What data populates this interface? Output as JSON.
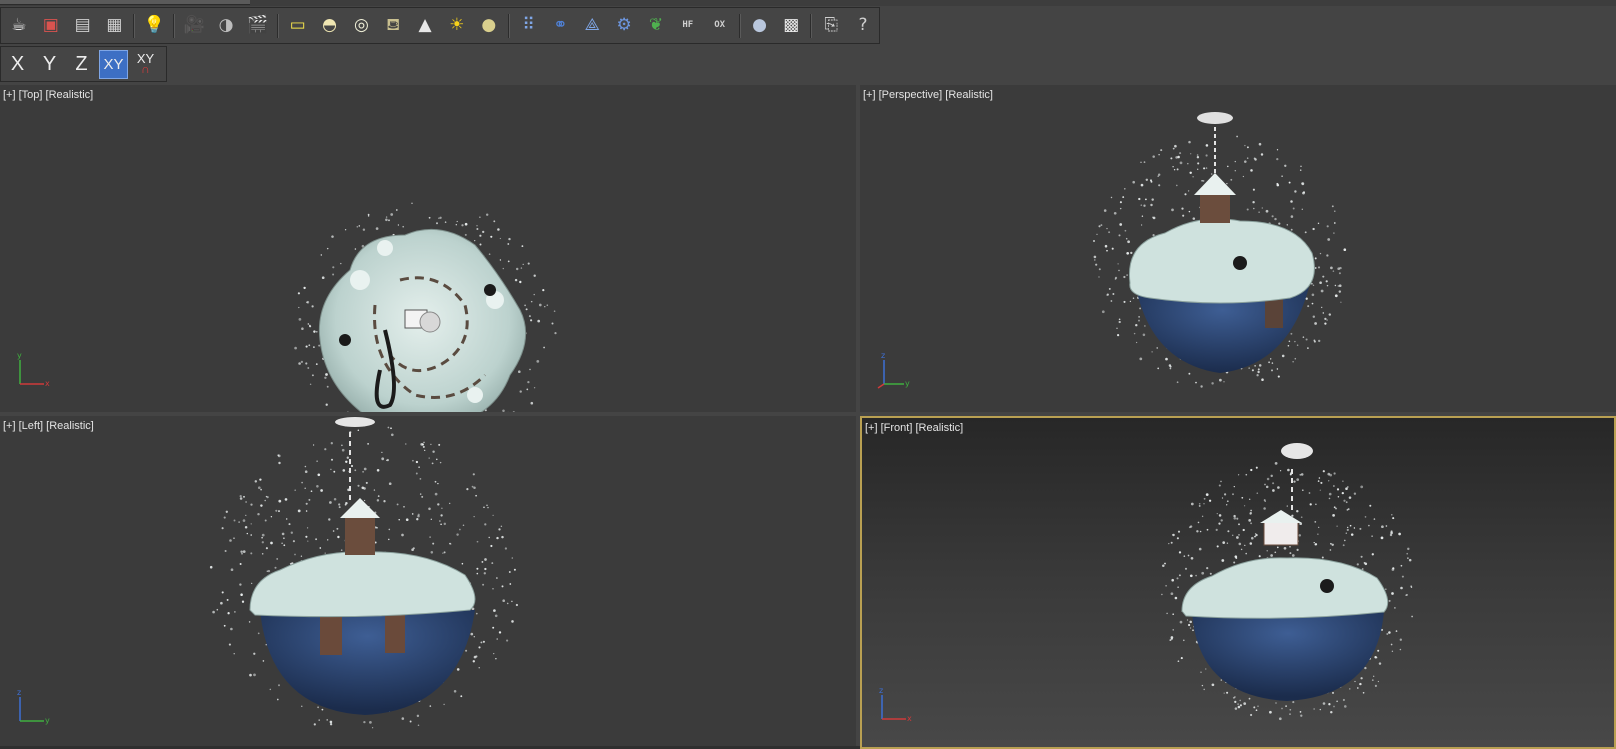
{
  "toolbar": {
    "groups": [
      [
        {
          "name": "teapot-icon",
          "glyph": "☕",
          "color": "#e8e8e8"
        },
        {
          "name": "render-frame-icon",
          "glyph": "▣",
          "color": "#d9534f"
        },
        {
          "name": "material-editor-icon",
          "glyph": "▤",
          "color": "#cfcfcf"
        },
        {
          "name": "schematic-view-icon",
          "glyph": "▦",
          "color": "#cfcfcf"
        }
      ],
      [
        {
          "name": "light-lister-icon",
          "glyph": "💡",
          "color": "#f2e14b"
        }
      ],
      [
        {
          "name": "camera-icon",
          "glyph": "🎥",
          "color": "#cfcfcf"
        },
        {
          "name": "sound-icon",
          "glyph": "◑",
          "color": "#bdbdbd"
        },
        {
          "name": "render-setup-icon",
          "glyph": "🎬",
          "color": "#d9534f"
        }
      ],
      [
        {
          "name": "plane-icon",
          "glyph": "▭",
          "color": "#f2e14b"
        },
        {
          "name": "dome-icon",
          "glyph": "◓",
          "color": "#efe6b2"
        },
        {
          "name": "ring-icon",
          "glyph": "◎",
          "color": "#f0f0d8"
        },
        {
          "name": "teapot-object-icon",
          "glyph": "⛾",
          "color": "#c9c090"
        },
        {
          "name": "cone-icon",
          "glyph": "▲",
          "color": "#e8e8e8"
        },
        {
          "name": "sun-icon",
          "glyph": "☀",
          "color": "#f7d21a"
        },
        {
          "name": "sphere-light-icon",
          "glyph": "●",
          "color": "#d9cf8d"
        }
      ],
      [
        {
          "name": "grid-array-icon",
          "glyph": "⠿",
          "color": "#7fa6e6"
        },
        {
          "name": "molecule-icon",
          "glyph": "⚭",
          "color": "#4f82d9"
        },
        {
          "name": "pyramid-icon",
          "glyph": "⟁",
          "color": "#7fa6e6"
        },
        {
          "name": "gear-icon",
          "glyph": "⚙",
          "color": "#6d96de"
        },
        {
          "name": "grass-icon",
          "glyph": "❦",
          "color": "#4fb04f"
        },
        {
          "name": "hair-fur-icon",
          "glyph": "HF",
          "color": "#cfcfcf",
          "small": true
        },
        {
          "name": "ox-shell-icon",
          "glyph": "OX",
          "color": "#cfcfcf",
          "small": true
        }
      ],
      [
        {
          "name": "material-sphere-icon",
          "glyph": "●",
          "color": "#b9c7dd"
        },
        {
          "name": "checker-map-icon",
          "glyph": "▩",
          "color": "#e8e8e8"
        }
      ],
      [
        {
          "name": "render-preset-icon",
          "glyph": "⎘",
          "color": "#cfcfcf"
        },
        {
          "name": "help-icon",
          "glyph": "?",
          "color": "#cfcfcf"
        }
      ]
    ]
  },
  "axis_toolbar": {
    "x": "X",
    "y": "Y",
    "z": "Z",
    "xy": "XY",
    "xy_snap_top": "XY",
    "xy_snap_bottom": "∩"
  },
  "viewports": {
    "top": {
      "plus": "[+]",
      "view": "[Top]",
      "shading": "[Realistic]",
      "axes": [
        "y",
        "x"
      ]
    },
    "persp": {
      "plus": "[+]",
      "view": "[Perspective]",
      "shading": "[Realistic]",
      "axes": [
        "z",
        "y"
      ]
    },
    "left": {
      "plus": "[+]",
      "view": "[Left]",
      "shading": "[Realistic]",
      "axes": [
        "z",
        "y"
      ]
    },
    "front": {
      "plus": "[+]",
      "view": "[Front]",
      "shading": "[Realistic]",
      "axes": [
        "z",
        "x"
      ]
    }
  },
  "colors": {
    "active_border": "#b9a052",
    "active_axis": "#3d6fc4",
    "snow": "#cfe2de",
    "globe": "#2e4a7a"
  }
}
